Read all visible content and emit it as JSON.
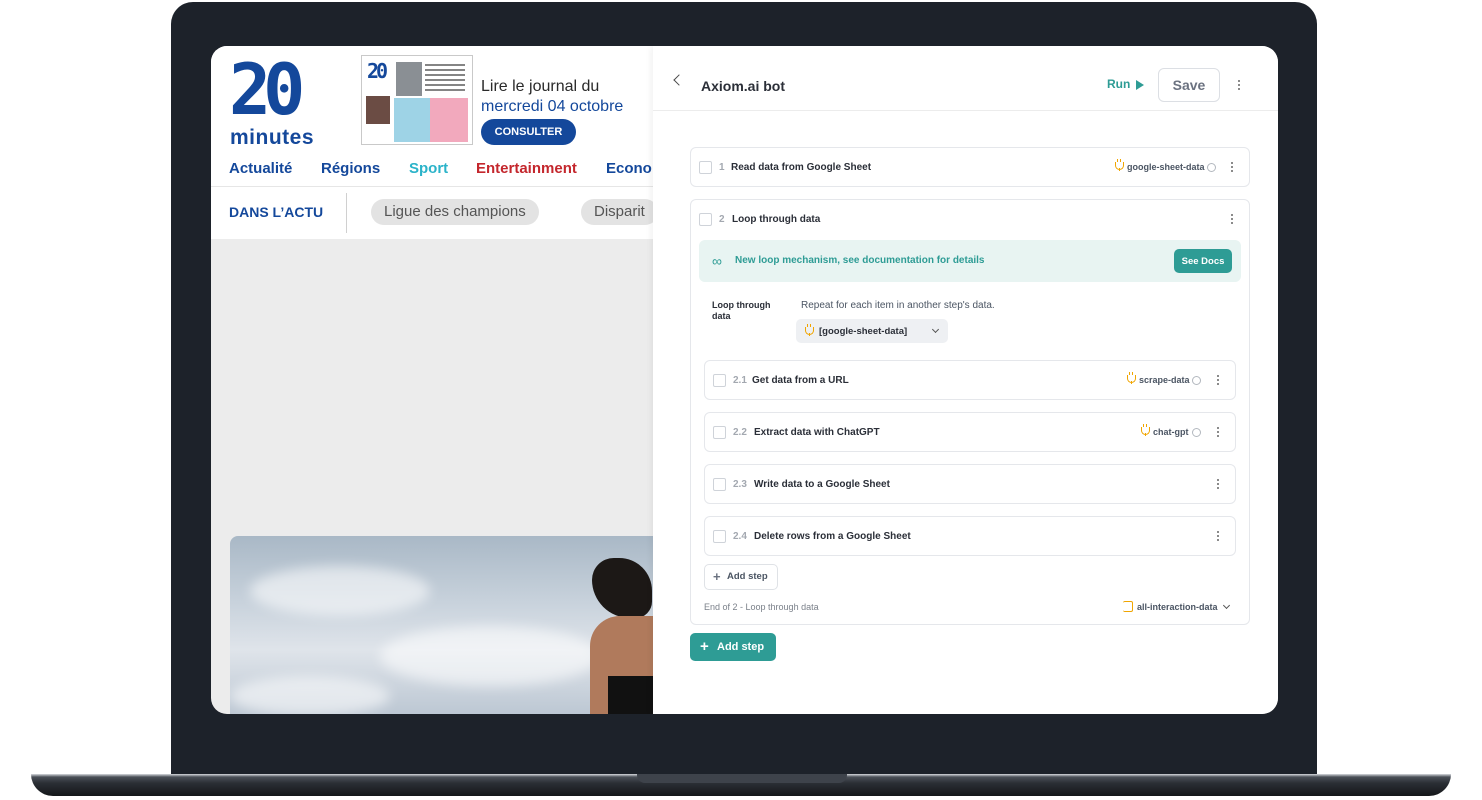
{
  "site": {
    "logo_number": "20",
    "logo_word": "minutes",
    "journal_line1": "Lire le journal du",
    "journal_line2": "mercredi 04 octobre",
    "consulter_label": "CONSULTER",
    "nav": [
      {
        "label": "Actualité",
        "color": "#14489b"
      },
      {
        "label": "Régions",
        "color": "#14489b"
      },
      {
        "label": "Sport",
        "color": "#2bb3c9"
      },
      {
        "label": "Entertainment",
        "color": "#c4272d"
      },
      {
        "label": "Econo",
        "color": "#14489b"
      }
    ],
    "dans_actu": "DANS L’ACTU",
    "pills": [
      "Ligue des champions",
      "Disparit"
    ]
  },
  "panel": {
    "title": "Axiom.ai bot",
    "run_label": "Run",
    "save_label": "Save",
    "accent": "#2e9c95",
    "steps": [
      {
        "num": "1",
        "title": "Read data from Google Sheet",
        "tag": "google-sheet-data"
      },
      {
        "num": "2",
        "title": "Loop through data"
      }
    ],
    "loop_banner": {
      "text": "New loop mechanism, see documentation for details",
      "button": "See Docs"
    },
    "loop": {
      "label": "Loop through data",
      "description": "Repeat for each item in another step's data.",
      "selected": "[google-sheet-data]"
    },
    "substeps": [
      {
        "num": "2.1",
        "title": "Get data from a URL",
        "tag": "scrape-data"
      },
      {
        "num": "2.2",
        "title": "Extract data with ChatGPT",
        "tag": "chat-gpt"
      },
      {
        "num": "2.3",
        "title": "Write data to a Google Sheet",
        "tag": ""
      },
      {
        "num": "2.4",
        "title": "Delete rows from a Google Sheet",
        "tag": ""
      }
    ],
    "add_step_inner": "Add step",
    "end_label": "End of 2 - Loop through data",
    "end_tag": "all-interaction-data",
    "add_step_outer": "Add step"
  }
}
